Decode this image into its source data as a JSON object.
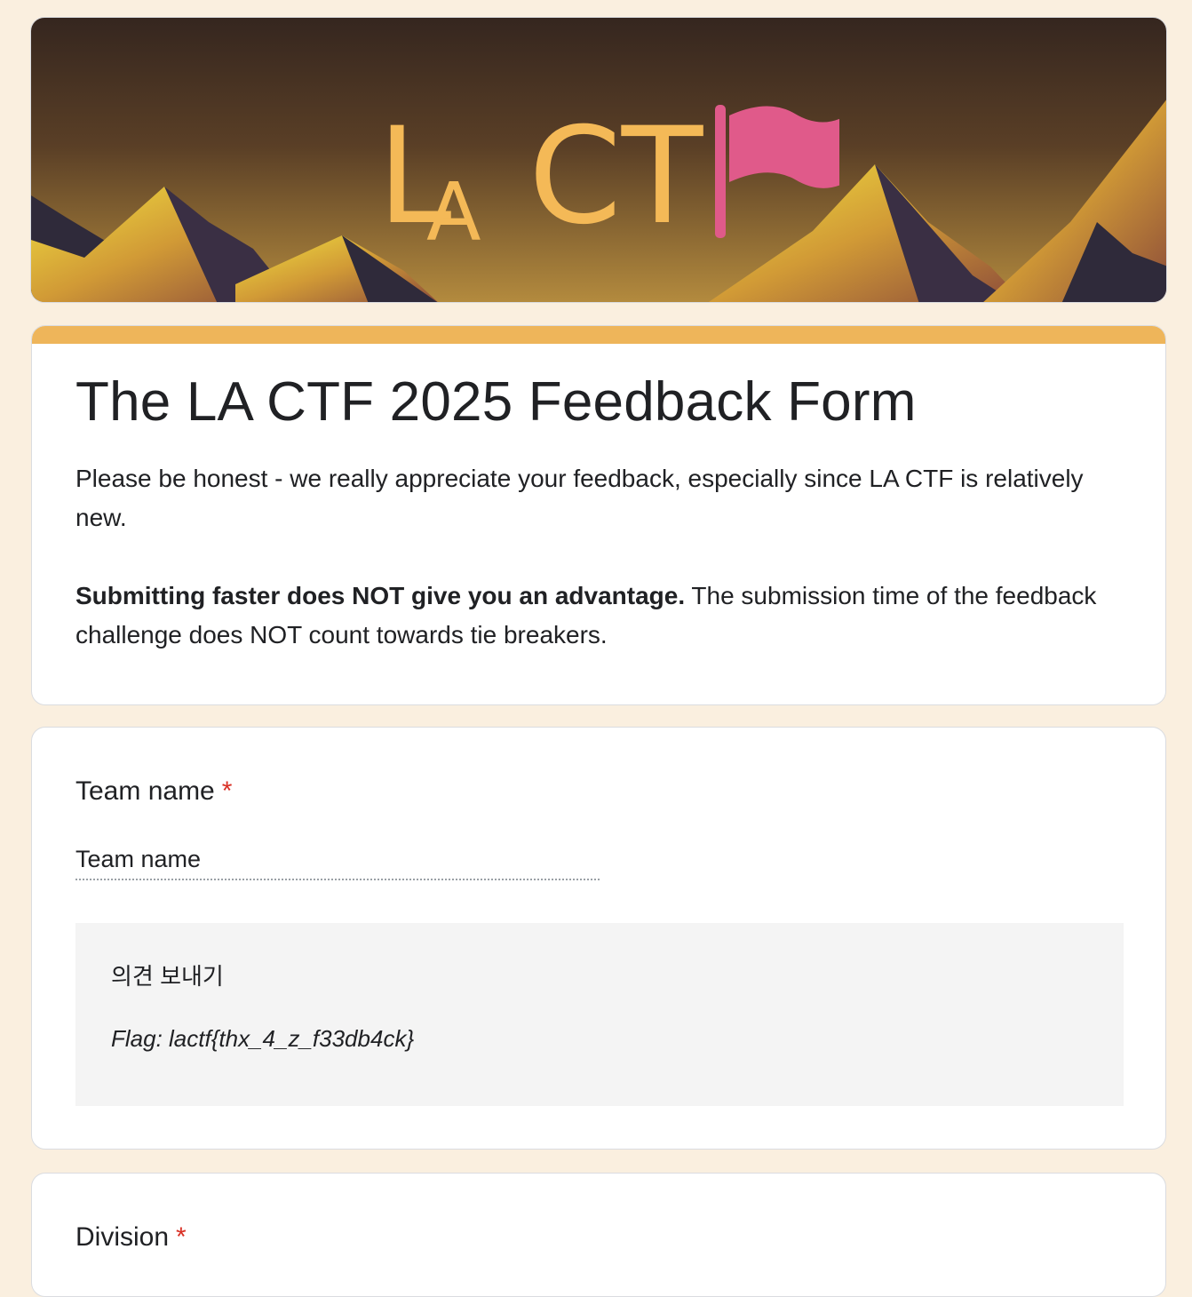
{
  "banner": {
    "logo_text": "LA CTF",
    "colors": {
      "sky_top": "#3a2922",
      "sky_bottom": "#b38a3d",
      "logo": "#f4b957",
      "flag": "#e05a8a"
    }
  },
  "form": {
    "accent_color": "#eeb55a",
    "title": "The LA CTF 2025 Feedback Form",
    "description_1": "Please be honest - we really appreciate your feedback, especially since LA CTF is relatively new.",
    "description_2_bold": "Submitting faster does NOT give you an advantage.",
    "description_2_rest": " The submission time of the feedback challenge does NOT count towards tie breakers."
  },
  "questions": [
    {
      "title": "Team name",
      "required_mark": "*",
      "answer": "Team name",
      "feedback_label": "의견 보내기",
      "feedback_text": "Flag: lactf{thx_4_z_f33db4ck}"
    },
    {
      "title": "Division",
      "required_mark": "*"
    }
  ]
}
